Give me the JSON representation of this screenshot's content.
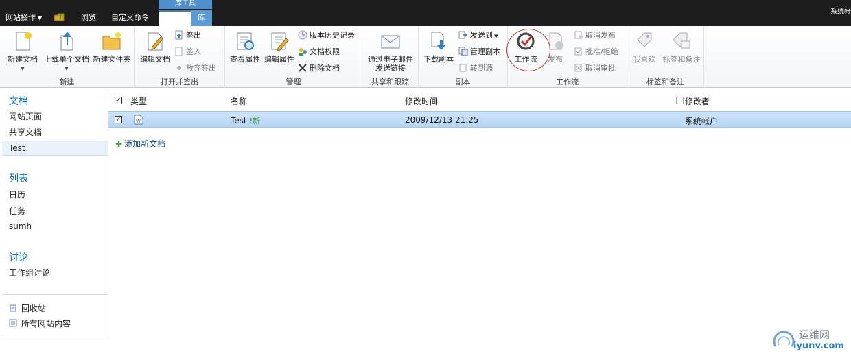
{
  "topbar": {
    "site_actions": "网站操作",
    "tab_browse": "浏览",
    "tab_custom": "自定义命令",
    "lib_tools": "库工具",
    "tab_doc": "文档",
    "tab_lib": "库",
    "account": "系统帐"
  },
  "ribbon": {
    "new_group": {
      "label": "新建",
      "new_doc": "新建文档",
      "upload": "上载单个文档",
      "new_folder": "新建文件夹"
    },
    "open_group": {
      "label": "打开并签出",
      "edit_doc": "编辑文档",
      "check_out": "签出",
      "check_in": "签入",
      "discard": "放弃签出"
    },
    "manage_group": {
      "label": "管理",
      "view_props": "查看属性",
      "edit_props": "编辑属性",
      "version_history": "版本历史记录",
      "doc_permissions": "文档权限",
      "delete_doc": "删除文档"
    },
    "share_group": {
      "label": "共享和跟踪",
      "email_link_1": "通过电子邮件",
      "email_link_2": "发送链接"
    },
    "copy_group": {
      "label": "副本",
      "download_copy": "下载副本",
      "send_to": "发送到",
      "manage_copies": "管理副本",
      "go_source": "转到源"
    },
    "workflow_group": {
      "label": "工作流",
      "workflow": "工作流",
      "publish": "发布",
      "unpublish": "取消发布",
      "approve": "批准/拒绝",
      "cancel_approval": "取消审批"
    },
    "tags_group": {
      "label": "标签和备注",
      "like": "我喜欢",
      "tags_notes": "标签和备注"
    }
  },
  "leftnav": {
    "docs_head": "文档",
    "docs_items": [
      "网站页面",
      "共享文档",
      "Test"
    ],
    "lists_head": "列表",
    "lists_items": [
      "日历",
      "任务",
      "sumh"
    ],
    "discuss_head": "讨论",
    "discuss_items": [
      "工作组讨论"
    ],
    "recycle": "回收站",
    "all_content": "所有网站内容"
  },
  "list": {
    "columns": {
      "type": "类型",
      "name": "名称",
      "modified": "修改时间",
      "modified_by": "修改者"
    },
    "rows": [
      {
        "name": "Test",
        "badge": "!新",
        "modified": "2009/12/13 21:25",
        "modified_by": "系统帐户"
      }
    ],
    "add_new": "添加新文档"
  },
  "watermark": {
    "line1": "运维网",
    "line2": "iyunv.com"
  }
}
